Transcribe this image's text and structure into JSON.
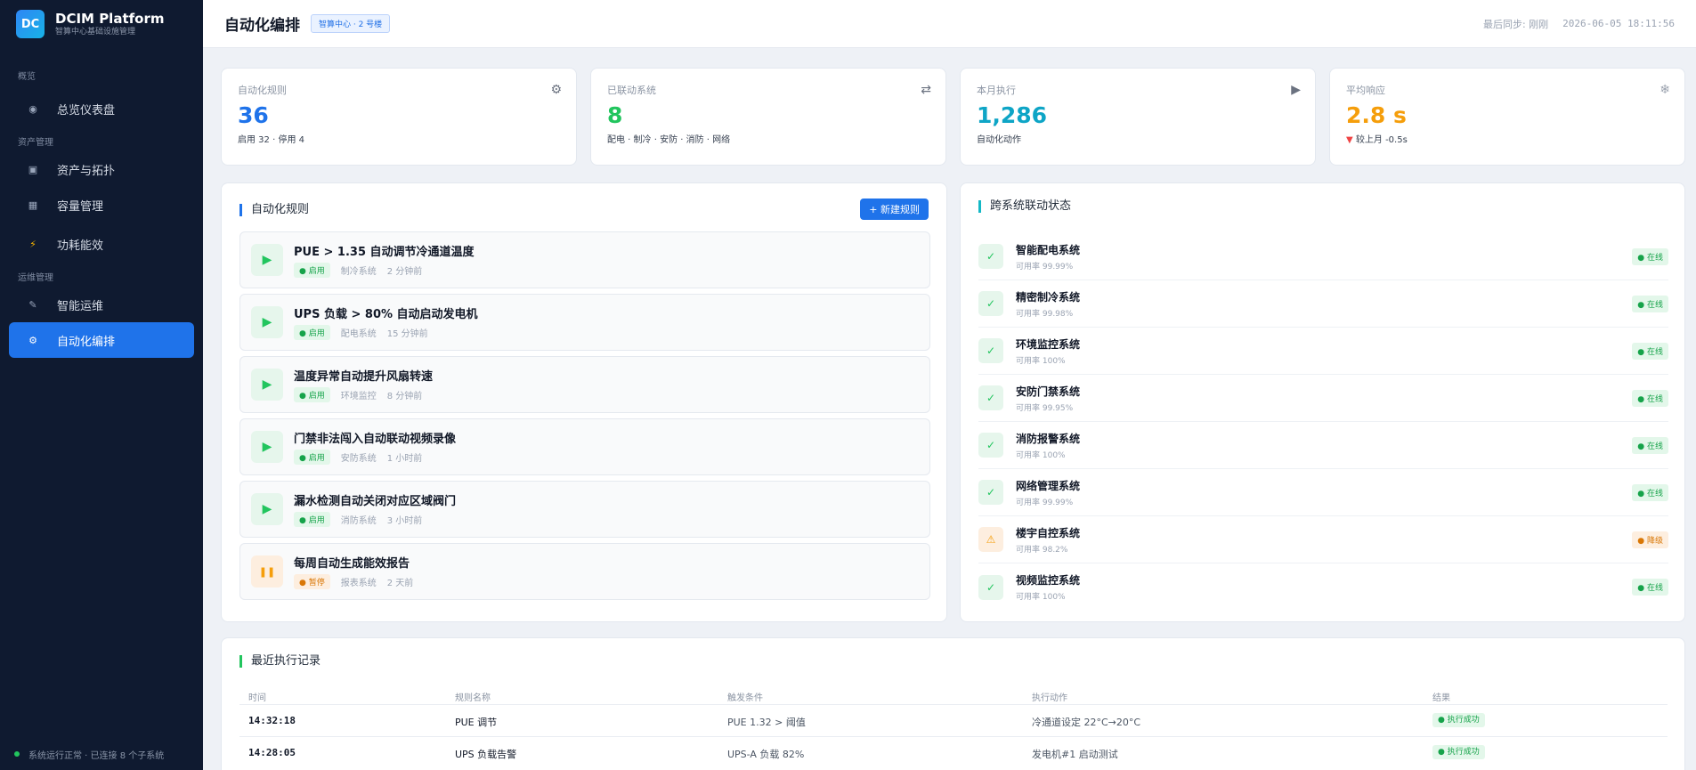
{
  "brand": {
    "logo": "DC",
    "title": "DCIM Platform",
    "subtitle": "智算中心基础设施管理"
  },
  "sidebar": {
    "groups": [
      "概览",
      "资产管理",
      "运维管理"
    ],
    "items": [
      {
        "label": "总览仪表盘",
        "icon": "dashboard-icon"
      },
      {
        "label": "资产与拓扑",
        "icon": "asset-icon"
      },
      {
        "label": "容量管理",
        "icon": "capacity-icon"
      },
      {
        "label": "功耗能效",
        "icon": "bolt-icon"
      },
      {
        "label": "智能运维",
        "icon": "wrench-icon"
      },
      {
        "label": "自动化编排",
        "icon": "gear-icon"
      }
    ],
    "footer": "系统运行正常 · 已连接 8 个子系统"
  },
  "header": {
    "title": "自动化编排",
    "location": "智算中心 · 2 号楼",
    "sync_label": "最后同步: 刚刚",
    "sync_time": "2026-06-05 18:11:56"
  },
  "kpis": [
    {
      "label": "自动化规则",
      "value": "36",
      "sub": "启用 32 · 停用 4",
      "icon": "gear-icon",
      "color": "#1f73ea"
    },
    {
      "label": "已联动系统",
      "value": "8",
      "sub": "配电 · 制冷 · 安防 · 消防 · 网络",
      "icon": "swap-icon",
      "color": "#22c55e"
    },
    {
      "label": "本月执行",
      "value": "1,286",
      "sub": "自动化动作",
      "icon": "play-icon",
      "color": "#0ea5c6"
    },
    {
      "label": "平均响应",
      "value": "2.8 s",
      "sub_arrow": "▼",
      "sub": "较上月 -0.5s",
      "icon": "sparkle-icon",
      "color": "#f59e0b"
    }
  ],
  "rules_panel": {
    "title": "自动化规则",
    "new_button": "+ 新建规则",
    "rules": [
      {
        "title": "PUE > 1.35 自动调节冷通道温度",
        "status": "启用",
        "system": "制冷系统",
        "time": "2 分钟前",
        "state": "on"
      },
      {
        "title": "UPS 负载 > 80% 自动启动发电机",
        "status": "启用",
        "system": "配电系统",
        "time": "15 分钟前",
        "state": "on"
      },
      {
        "title": "温度异常自动提升风扇转速",
        "status": "启用",
        "system": "环境监控",
        "time": "8 分钟前",
        "state": "on"
      },
      {
        "title": "门禁非法闯入自动联动视频录像",
        "status": "启用",
        "system": "安防系统",
        "time": "1 小时前",
        "state": "on"
      },
      {
        "title": "漏水检测自动关闭对应区域阀门",
        "status": "启用",
        "system": "消防系统",
        "time": "3 小时前",
        "state": "on"
      },
      {
        "title": "每周自动生成能效报告",
        "status": "暂停",
        "system": "报表系统",
        "time": "2 天前",
        "state": "off"
      }
    ]
  },
  "systems_panel": {
    "title": "跨系统联动状态",
    "systems": [
      {
        "name": "智能配电系统",
        "avail": "可用率 99.99%",
        "status": "在线",
        "state": "ok"
      },
      {
        "name": "精密制冷系统",
        "avail": "可用率 99.98%",
        "status": "在线",
        "state": "ok"
      },
      {
        "name": "环境监控系统",
        "avail": "可用率 100%",
        "status": "在线",
        "state": "ok"
      },
      {
        "name": "安防门禁系统",
        "avail": "可用率 99.95%",
        "status": "在线",
        "state": "ok"
      },
      {
        "name": "消防报警系统",
        "avail": "可用率 100%",
        "status": "在线",
        "state": "ok"
      },
      {
        "name": "网络管理系统",
        "avail": "可用率 99.99%",
        "status": "在线",
        "state": "ok"
      },
      {
        "name": "楼宇自控系统",
        "avail": "可用率 98.2%",
        "status": "降级",
        "state": "warn"
      },
      {
        "name": "视频监控系统",
        "avail": "可用率 100%",
        "status": "在线",
        "state": "ok"
      }
    ]
  },
  "log_panel": {
    "title": "最近执行记录",
    "columns": [
      "时间",
      "规则名称",
      "触发条件",
      "执行动作",
      "结果"
    ],
    "rows": [
      {
        "time": "14:32:18",
        "rule": "PUE 调节",
        "trigger": "PUE 1.32 > 阈值",
        "action": "冷通道设定 22°C→20°C",
        "result": "执行成功"
      },
      {
        "time": "14:28:05",
        "rule": "UPS 负载告警",
        "trigger": "UPS-A 负载 82%",
        "action": "发电机#1 启动测试",
        "result": "执行成功"
      }
    ]
  }
}
